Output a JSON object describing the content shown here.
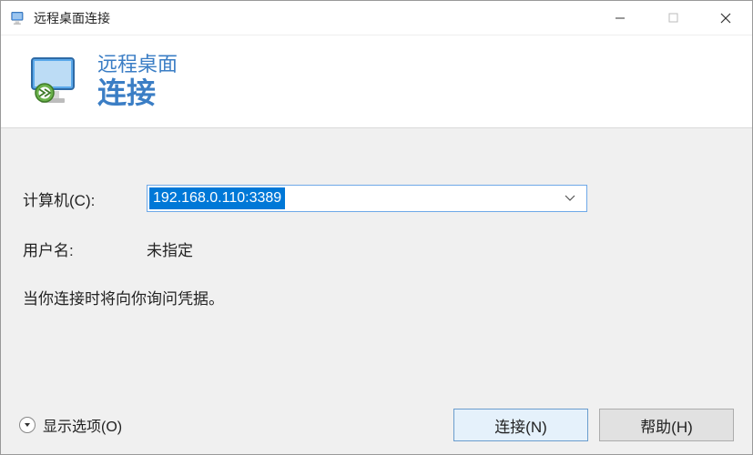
{
  "window": {
    "title": "远程桌面连接"
  },
  "banner": {
    "line1": "远程桌面",
    "line2": "连接"
  },
  "form": {
    "computer_label": "计算机(C):",
    "computer_value": "192.168.0.110:3389",
    "username_label": "用户名:",
    "username_value": "未指定",
    "info": "当你连接时将向你询问凭据。"
  },
  "buttons": {
    "show_options": "显示选项(O)",
    "connect": "连接(N)",
    "help": "帮助(H)"
  }
}
